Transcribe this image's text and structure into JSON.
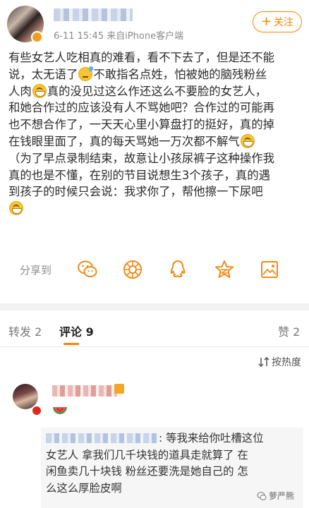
{
  "header": {
    "meta": "6-11 15:45  来自iPhone客户端",
    "follow_label": "关注",
    "follow_plus": "+"
  },
  "post": {
    "lines": [
      "有些女艺人吃相真的难看，看不下去了，但是还不能",
      "说，太无语了",
      "不敢指名点姓，怕被她的脑残粉丝",
      "人肉",
      "真的没见过这么作还这么不要脸的女艺人，",
      "和她合作过的应该没有人不骂她吧？合作过的可能再",
      "也不想合作了，一天天心里小算盘打的挺好，真的掉",
      "在钱眼里面了，真的每天骂她一万次都不解气",
      "（为了早点录制结束，故意让小孩尿裤子这种操作我",
      "真的也是不懂，在别的节目说想生3个孩子，真的遇",
      "到孩子的时候只会说：我求你了，帮他擦一下尿吧"
    ],
    "emojis": {
      "sweat": "sweat-emoji",
      "grin": "grin-emoji"
    }
  },
  "share": {
    "label": "分享到",
    "icons": [
      "wechat-icon",
      "moments-icon",
      "qq-icon",
      "qzone-star-icon",
      "album-icon"
    ]
  },
  "tabs": {
    "repost": "转发 2",
    "comment": "评论 9",
    "like": "赞 2"
  },
  "sort": {
    "label": "按热度"
  },
  "comment": {
    "quote_lines": [
      ": 等我来给你吐槽这位",
      "女艺人  拿我们几千块钱的道具走就算了  在",
      "闲鱼卖几十块钱  粉丝还要洗是她自己的  怎",
      "么这么厚脸皮啊"
    ]
  },
  "watermark": {
    "label": "萝严熊"
  },
  "colors": {
    "accent": "#ff8200",
    "link": "#4a7ab8",
    "divider": "#f2f2f2"
  }
}
